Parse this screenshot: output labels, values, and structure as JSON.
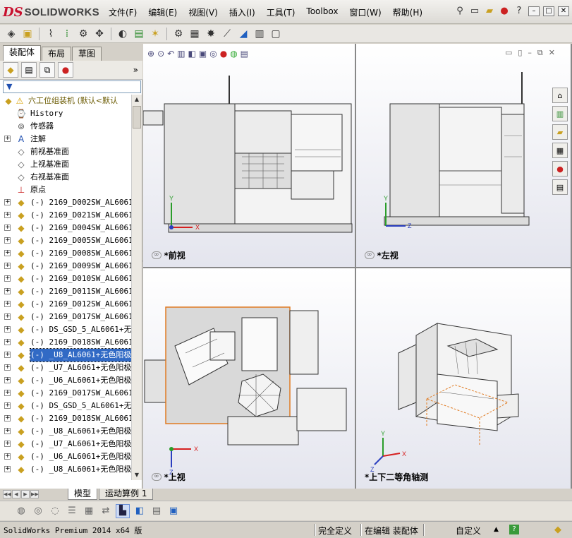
{
  "app": {
    "brand_prefix": "DS",
    "brand_name": "SOLIDWORKS"
  },
  "menu": [
    "文件(F)",
    "编辑(E)",
    "视图(V)",
    "插入(I)",
    "工具(T)",
    "Toolbox",
    "窗口(W)",
    "帮助(H)"
  ],
  "title_icons": [
    "pin-icon",
    "new-document-icon",
    "open-icon",
    "traffic-light-icon",
    "help-icon"
  ],
  "panel_tabs": [
    "装配体",
    "布局",
    "草图"
  ],
  "panel_icons": [
    "feature-manager-icon",
    "property-manager-icon",
    "configuration-manager-icon",
    "display-manager-icon"
  ],
  "filter_symbol": "▼",
  "tree": {
    "root": "六工位组装机  (默认<默认",
    "items": [
      {
        "label": "History",
        "icon": "history-icon",
        "expand": ""
      },
      {
        "label": "传感器",
        "icon": "sensor-icon",
        "expand": ""
      },
      {
        "label": "注解",
        "icon": "annotation-icon",
        "expand": "+"
      },
      {
        "label": "前视基准面",
        "icon": "plane-icon",
        "expand": ""
      },
      {
        "label": "上视基准面",
        "icon": "plane-icon",
        "expand": ""
      },
      {
        "label": "右视基准面",
        "icon": "plane-icon",
        "expand": ""
      },
      {
        "label": "原点",
        "icon": "origin-icon",
        "expand": ""
      },
      {
        "label": "(-) 2169_D002SW_AL6061+无",
        "icon": "part-icon",
        "expand": "+"
      },
      {
        "label": "(-) 2169_D021SW_AL6061+无",
        "icon": "part-icon",
        "expand": "+"
      },
      {
        "label": "(-) 2169_D004SW_AL6061+无",
        "icon": "part-icon",
        "expand": "+"
      },
      {
        "label": "(-) 2169_D005SW_AL6061+无",
        "icon": "part-icon",
        "expand": "+"
      },
      {
        "label": "(-) 2169_D008SW_AL6061+无",
        "icon": "part-icon",
        "expand": "+"
      },
      {
        "label": "(-) 2169_D009SW_AL6061+无",
        "icon": "part-icon",
        "expand": "+"
      },
      {
        "label": "(-) 2169_D010SW_AL6061+无",
        "icon": "part-icon",
        "expand": "+"
      },
      {
        "label": "(-) 2169_D011SW_AL6061+无",
        "icon": "part-icon",
        "expand": "+"
      },
      {
        "label": "(-) 2169_D012SW_AL6061+无",
        "icon": "part-icon",
        "expand": "+"
      },
      {
        "label": "(-) 2169_D017SW_AL6061+无",
        "icon": "part-icon",
        "expand": "+"
      },
      {
        "label": "(-) DS_GSD_5_AL6061+无色",
        "icon": "part-icon",
        "expand": "+"
      },
      {
        "label": "(-) 2169_D018SW_AL6061+无",
        "icon": "part-icon",
        "expand": "+"
      },
      {
        "label": "(-) _U8_AL6061+无色阳极<",
        "icon": "part-icon",
        "expand": "+",
        "selected": true
      },
      {
        "label": "(-) _U7_AL6061+无色阳极<",
        "icon": "part-icon",
        "expand": "+"
      },
      {
        "label": "(-) _U6_AL6061+无色阳极<",
        "icon": "part-icon",
        "expand": "+"
      },
      {
        "label": "(-) 2169_D017SW_AL6061+无",
        "icon": "part-icon",
        "expand": "+"
      },
      {
        "label": "(-) DS_GSD_5_AL6061+无色",
        "icon": "part-icon",
        "expand": "+"
      },
      {
        "label": "(-) 2169_D018SW_AL6061+无",
        "icon": "part-icon",
        "expand": "+"
      },
      {
        "label": "(-) _U8_AL6061+无色阳极<",
        "icon": "part-icon",
        "expand": "+"
      },
      {
        "label": "(-) _U7_AL6061+无色阳极<",
        "icon": "part-icon",
        "expand": "+"
      },
      {
        "label": "(-) _U6_AL6061+无色阳极<",
        "icon": "part-icon",
        "expand": "+"
      },
      {
        "label": "(-) _U8_AL6061+无色阳极<",
        "icon": "part-icon",
        "expand": "+"
      }
    ]
  },
  "views": {
    "front": "*前视",
    "left": "*左视",
    "top": "*上视",
    "iso": "*上下二等角轴测"
  },
  "axes": {
    "x": "X",
    "y": "Y",
    "z": "Z"
  },
  "bottom_tabs": [
    "模型",
    "运动算例 1"
  ],
  "status": {
    "product": "SolidWorks Premium 2014 x64 版",
    "definition": "完全定义",
    "editing": "在编辑 装配体",
    "units": "自定义",
    "units_arrow": "▲"
  },
  "colors": {
    "selection": "#316ac5",
    "highlight_orange": "#e07b22",
    "axis_red": "#d62020",
    "axis_green": "#2a9d2a",
    "axis_blue": "#2b3fbf"
  }
}
